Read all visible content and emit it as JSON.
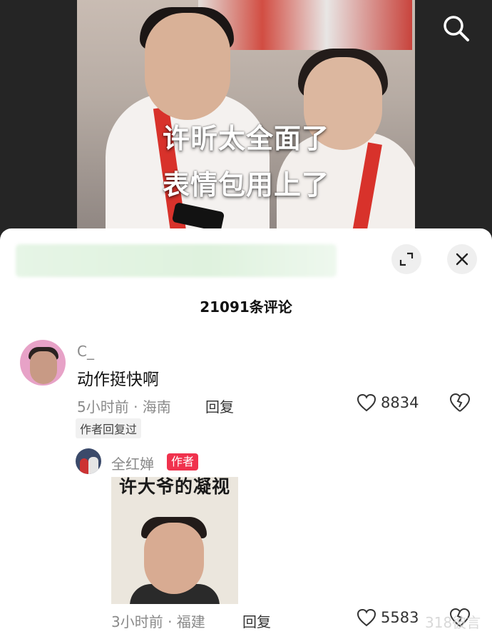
{
  "video": {
    "caption_line1": "许昕太全面了",
    "caption_line2": "表情包用上了",
    "search_icon": "search-icon"
  },
  "comments_panel": {
    "count_label": "21091条评论",
    "expand_icon": "expand-icon",
    "close_icon": "close-icon",
    "comments": [
      {
        "username": "C_",
        "text": "动作挺快啊",
        "meta": "5小时前 · 海南",
        "reply_label": "回复",
        "likes": "8834",
        "author_replied_label": "作者回复过"
      }
    ],
    "reply": {
      "username": "全红婵",
      "author_badge": "作者",
      "meme_text": "许大爷的凝视",
      "meta": "3小时前 · 福建",
      "reply_label": "回复",
      "likes": "5583"
    }
  },
  "watermark": "318彼言",
  "colors": {
    "author_badge": "#f0324d",
    "panel_bg": "#ffffff",
    "meta_text": "#8a8a8a"
  }
}
